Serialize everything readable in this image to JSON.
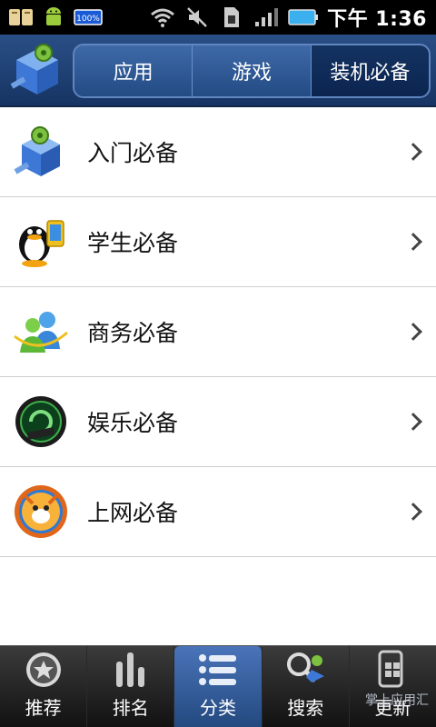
{
  "statusbar": {
    "battery_label": "100%",
    "time": "下午 1:36",
    "icons": [
      "book-icon",
      "android-icon",
      "battery-indicator-icon",
      "wifi-icon",
      "mute-icon",
      "sim-icon",
      "signal-icon",
      "battery-icon"
    ]
  },
  "header": {
    "logo_icon": "app-logo-cube-icon",
    "tabs": [
      {
        "label": "应用"
      },
      {
        "label": "游戏"
      },
      {
        "label": "装机必备"
      }
    ],
    "active_tab_index": 2
  },
  "list": {
    "items": [
      {
        "label": "入门必备",
        "icon": "cube-gear-icon"
      },
      {
        "label": "学生必备",
        "icon": "qq-penguin-icon"
      },
      {
        "label": "商务必备",
        "icon": "messenger-people-icon"
      },
      {
        "label": "娱乐必备",
        "icon": "games-360-icon"
      },
      {
        "label": "上网必备",
        "icon": "uc-squirrel-icon"
      }
    ]
  },
  "bottomnav": {
    "items": [
      {
        "label": "推荐",
        "icon": "star-icon"
      },
      {
        "label": "排名",
        "icon": "bars-icon"
      },
      {
        "label": "分类",
        "icon": "list-icon"
      },
      {
        "label": "搜索",
        "icon": "search-icon"
      },
      {
        "label": "更新",
        "icon": "update-phone-icon"
      }
    ],
    "active_index": 2,
    "watermark": "掌上应用汇"
  },
  "colors": {
    "header_blue": "#1e3f73",
    "tab_active": "#0b2550",
    "nav_active": "#3b67a8"
  }
}
